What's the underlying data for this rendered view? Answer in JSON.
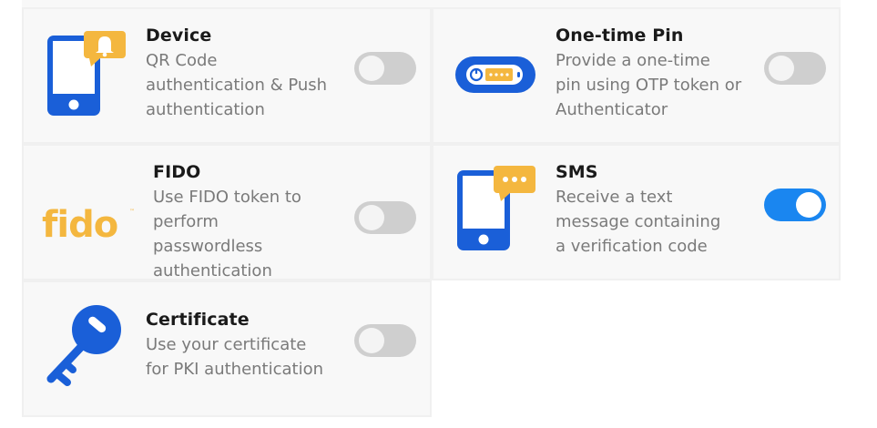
{
  "methods": [
    {
      "title": "Device",
      "desc": [
        "QR Code",
        "authentication & Push",
        "authentication"
      ],
      "enabled": false,
      "icon": "phone-bell-icon"
    },
    {
      "title": "One-time Pin",
      "desc": [
        "Provide a one-time",
        "pin using OTP token or",
        "Authenticator"
      ],
      "enabled": false,
      "icon": "otp-token-icon"
    },
    {
      "title": "FIDO",
      "desc": [
        "Use FIDO token to",
        "perform",
        "passwordless",
        "authentication"
      ],
      "enabled": false,
      "icon": "fido-logo-icon",
      "logo_text": "fido"
    },
    {
      "title": "SMS",
      "desc": [
        "Receive a text",
        "message containing",
        "a verification code"
      ],
      "enabled": true,
      "icon": "phone-message-icon"
    },
    {
      "title": "Certificate",
      "desc": [
        "Use your certificate",
        "for PKI authentication"
      ],
      "enabled": false,
      "icon": "key-icon"
    }
  ],
  "colors": {
    "accent_blue": "#1a5fd8",
    "accent_yellow": "#f4b73f",
    "toggle_on": "#1a86f0",
    "toggle_off": "#cfcfcf"
  }
}
